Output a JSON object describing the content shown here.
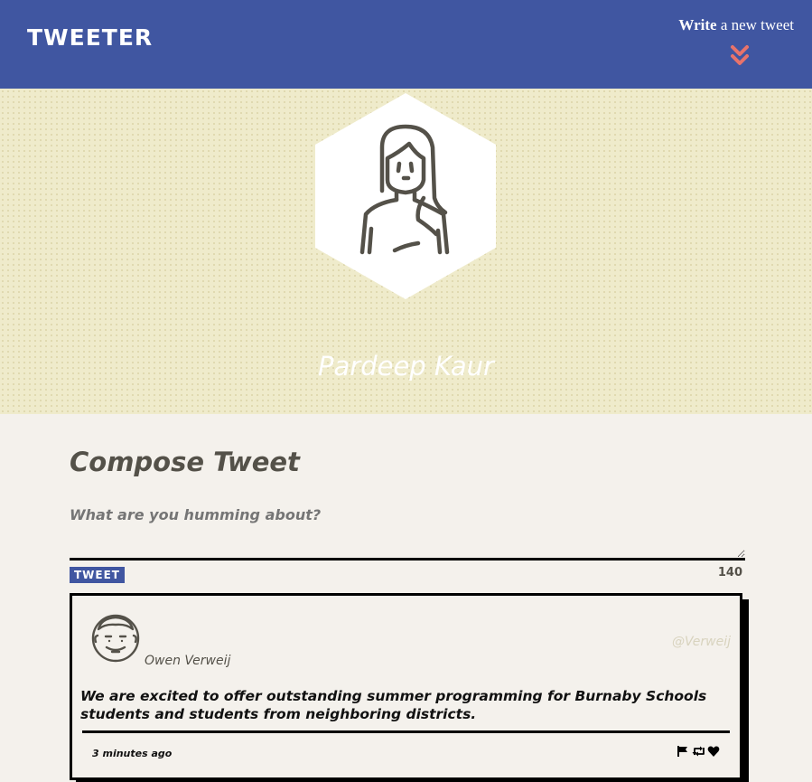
{
  "nav": {
    "brand": "TWEETER",
    "compose_bold": "Write",
    "compose_rest": " a new tweet",
    "chevron_icon": "double-chevron-down-icon",
    "accent_color": "#e8736b",
    "bar_color": "#4056a1"
  },
  "profile": {
    "name": "Pardeep Kaur",
    "avatar_icon": "woman-avatar-icon"
  },
  "compose": {
    "title": "Compose Tweet",
    "placeholder": "What are you humming about?",
    "button_label": "TWEET",
    "counter": "140"
  },
  "tweet": {
    "author": "Owen Verweij",
    "handle": "@Verweij",
    "text": "We are excited to offer outstanding summer programming for Burnaby Schools students and students from neighboring districts.",
    "time": "3 minutes ago",
    "avatar_icon": "man-avatar-icon",
    "actions": [
      "flag-icon",
      "retweet-icon",
      "heart-icon"
    ]
  }
}
